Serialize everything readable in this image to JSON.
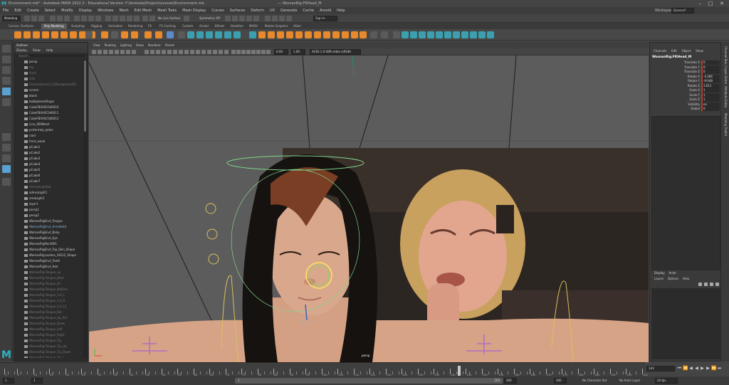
{
  "titlebar": {
    "title": "Environment.mb* - Autodesk MAYA 2022.3 - Educational Version: F:\\Andrada\\Projects\\scenes\\Environment.mb",
    "node_path": "---  WomanRig:FKHead_M"
  },
  "menubar": {
    "items": [
      "File",
      "Edit",
      "Create",
      "Select",
      "Modify",
      "Display",
      "Windows",
      "Mesh",
      "Edit Mesh",
      "Mesh Tools",
      "Mesh Display",
      "Curves",
      "Surfaces",
      "Deform",
      "UV",
      "Generate",
      "Cache",
      "Arnold",
      "Help"
    ],
    "workspace_label": "Workspace :",
    "workspace_value": "General*"
  },
  "statusline": {
    "mode": "Modeling",
    "no_live_surface": "No Live Surface",
    "symmetry": "Symmetry: Off",
    "sign_in": "Sign In"
  },
  "shelf": {
    "tabs": [
      "Curves / Surfaces",
      "Poly Modeling",
      "Sculpting",
      "Rigging",
      "Animation",
      "Rendering",
      "FX",
      "FX Caching",
      "Custom",
      "Arnold",
      "Bifrost",
      "Deadline",
      "MASH",
      "Motion Graphics",
      "XGen"
    ],
    "active_tab": "Poly Modeling"
  },
  "outliner": {
    "title": "Outliner",
    "menu": [
      "Display",
      "Show",
      "Help"
    ],
    "search_placeholder": "Search...",
    "items": [
      {
        "label": "persp",
        "style": "normal"
      },
      {
        "label": "top",
        "style": "dim"
      },
      {
        "label": "front",
        "style": "dim"
      },
      {
        "label": "side",
        "style": "dim"
      },
      {
        "label": "GenericScene1_01Background01",
        "style": "dim"
      },
      {
        "label": "screen",
        "style": "normal"
      },
      {
        "label": "blank",
        "style": "normal"
      },
      {
        "label": "bobbybeanShape",
        "style": "normal"
      },
      {
        "label": "CubeFBXASC046010",
        "style": "normal"
      },
      {
        "label": "CubeFBXASC046011",
        "style": "normal"
      },
      {
        "label": "CubeFBXASC046013",
        "style": "normal"
      },
      {
        "label": "Line_000Mesh",
        "style": "normal"
      },
      {
        "label": "prsformka_qrdos",
        "style": "normal"
      },
      {
        "label": "rzed",
        "style": "normal"
      },
      {
        "label": "front_wood",
        "style": "normal"
      },
      {
        "label": "pCube1",
        "style": "normal"
      },
      {
        "label": "pCube2",
        "style": "normal"
      },
      {
        "label": "pCube3",
        "style": "normal"
      },
      {
        "label": "pCube4",
        "style": "normal"
      },
      {
        "label": "pCube5",
        "style": "normal"
      },
      {
        "label": "pCube6",
        "style": "normal"
      },
      {
        "label": "pCube7",
        "style": "normal"
      },
      {
        "label": "defaultLightSet",
        "style": "dim"
      },
      {
        "label": "aiAreaLight1",
        "style": "normal"
      },
      {
        "label": "areaLight1",
        "style": "normal"
      },
      {
        "label": "layer1",
        "style": "normal"
      },
      {
        "label": "persp1",
        "style": "normal"
      },
      {
        "label": "persp2",
        "style": "normal"
      },
      {
        "label": "WomanRigEnvt_Tongue",
        "style": "normal"
      },
      {
        "label": "WomanRigEnvt_ArmeKetd",
        "style": "blue"
      },
      {
        "label": "WomanRigEnvt_Body",
        "style": "normal"
      },
      {
        "label": "WomanRigEnvt_Eye",
        "style": "normal"
      },
      {
        "label": "WomanRigPoint001",
        "style": "normal"
      },
      {
        "label": "WomanRigEnvt_Top_Skin_Shape",
        "style": "normal"
      },
      {
        "label": "WomanRig:Lashes_18112_Shape",
        "style": "normal"
      },
      {
        "label": "WomanRigEnvt_Teeth",
        "style": "normal"
      },
      {
        "label": "WomanRigEnvt_Hair",
        "style": "normal"
      },
      {
        "label": "WomanRig:Tongue_up",
        "style": "dim"
      },
      {
        "label": "WomanRig:Tongue_Base",
        "style": "dim"
      },
      {
        "label": "WomanRig:Tongue_Dn",
        "style": "dim"
      },
      {
        "label": "WomanRig:Tongue_Mid2nd",
        "style": "dim"
      },
      {
        "label": "WomanRig:Tongue_Cuf_L",
        "style": "dim"
      },
      {
        "label": "WomanRig:Tongue_Cuf_R",
        "style": "dim"
      },
      {
        "label": "WomanRig:Tongue_Cuf_L2",
        "style": "dim"
      },
      {
        "label": "WomanRig:Tongue_Bot",
        "style": "dim"
      },
      {
        "label": "WomanRig:Tongue_Up_Rot",
        "style": "dim"
      },
      {
        "label": "WomanRig:Tongue_Down",
        "style": "dim"
      },
      {
        "label": "WomanRig:Tongue_Left",
        "style": "dim"
      },
      {
        "label": "WomanRig:Tongue_Right",
        "style": "dim"
      },
      {
        "label": "WomanRig:Tongue_Tip",
        "style": "dim"
      },
      {
        "label": "WomanRig:Tongue_Tip_Up",
        "style": "dim"
      },
      {
        "label": "WomanRig:Tongue_Tip_Down",
        "style": "dim"
      },
      {
        "label": "WomanRig:Tongue_Tip_L",
        "style": "dim"
      }
    ]
  },
  "viewport": {
    "menu": [
      "View",
      "Shading",
      "Lighting",
      "Show",
      "Renderer",
      "Panels"
    ],
    "exposure": "0.00",
    "gamma": "1.00",
    "color_space": "ACES 1.0 SDR-video (sRGB)",
    "camera_label": "persp"
  },
  "channelbox": {
    "tabs": [
      "Channels",
      "Edit",
      "Object",
      "Show"
    ],
    "node_name": "WomanRig:FKHead_M",
    "channels": [
      {
        "name": "Translate X",
        "value": "0"
      },
      {
        "name": "Translate Y",
        "value": "0"
      },
      {
        "name": "Translate Z",
        "value": "0"
      },
      {
        "name": "Rotate X",
        "value": "-4.286"
      },
      {
        "name": "Rotate Y",
        "value": "-9.048"
      },
      {
        "name": "Rotate Z",
        "value": "3.611"
      },
      {
        "name": "Scale X",
        "value": "1"
      },
      {
        "name": "Scale Y",
        "value": "1"
      },
      {
        "name": "Scale Z",
        "value": "1"
      },
      {
        "name": "Visibility",
        "value": "on"
      },
      {
        "name": "Global",
        "value": "0"
      }
    ],
    "layer_tabs": [
      "Display",
      "Anim"
    ],
    "layer_menu": [
      "Layers",
      "Options",
      "Help"
    ]
  },
  "sidetabs": [
    "Channel Box / Layer Editor",
    "Attribute Editor",
    "Modeling Toolkit"
  ],
  "timeslider": {
    "labels": [
      "1",
      "5",
      "10",
      "15",
      "20",
      "25",
      "30",
      "35",
      "40",
      "45",
      "50",
      "55",
      "60",
      "65",
      "70",
      "75",
      "80",
      "85",
      "90",
      "95",
      "100",
      "105",
      "110",
      "115",
      "120",
      "125",
      "130",
      "135",
      "140",
      "145",
      "150",
      "155",
      "160",
      "165",
      "170",
      "175",
      "180",
      "185",
      "190",
      "195",
      "200"
    ],
    "current_frame": "143"
  },
  "rangeslider": {
    "start": "1",
    "playback_start": "1",
    "range_label": "1",
    "range_end_label": "200",
    "playback_end": "200",
    "end": "200",
    "character_set": "No Character Set",
    "anim_layer": "No Anim Layer",
    "fps": "24 fps"
  }
}
